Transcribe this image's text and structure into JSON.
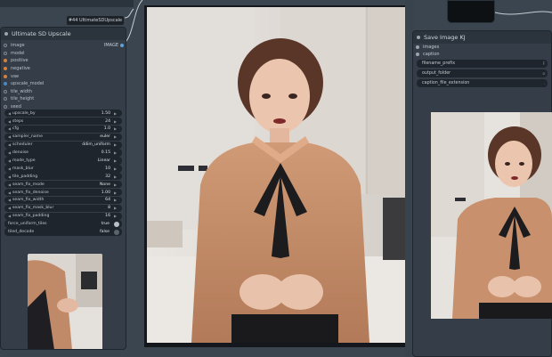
{
  "colors": {
    "canvas": "#3a4550",
    "node_bg": "#353e48",
    "widget_bg": "#1e252c",
    "socket_orange": "#d4823a",
    "socket_blue": "#4f87c9"
  },
  "mini_node": {
    "label": "#44 UltimateSDUpscale"
  },
  "upscale_node": {
    "title": "Ultimate SD Upscale",
    "inputs": [
      {
        "label": "image",
        "socket": "hollow"
      },
      {
        "label": "model",
        "socket": "hollow"
      },
      {
        "label": "positive",
        "socket": "orange"
      },
      {
        "label": "negative",
        "socket": "orange"
      },
      {
        "label": "vae",
        "socket": "orange"
      },
      {
        "label": "upscale_model",
        "socket": "blue"
      },
      {
        "label": "tile_width",
        "socket": "hollow"
      },
      {
        "label": "tile_height",
        "socket": "hollow"
      },
      {
        "label": "seed",
        "socket": "hollow"
      }
    ],
    "output_label": "IMAGE",
    "widgets": [
      {
        "label": "upscale_by",
        "value": "1.50"
      },
      {
        "label": "steps",
        "value": "24"
      },
      {
        "label": "cfg",
        "value": "1.0"
      },
      {
        "label": "sampler_name",
        "value": "euler"
      },
      {
        "label": "scheduler",
        "value": "ddim_uniform"
      },
      {
        "label": "denoise",
        "value": "0.15"
      },
      {
        "label": "mode_type",
        "value": "Linear"
      },
      {
        "label": "mask_blur",
        "value": "10"
      },
      {
        "label": "tile_padding",
        "value": "32"
      },
      {
        "label": "seam_fix_mode",
        "value": "None"
      },
      {
        "label": "seam_fix_denoise",
        "value": "1.00"
      },
      {
        "label": "seam_fix_width",
        "value": "64"
      },
      {
        "label": "seam_fix_mask_blur",
        "value": "8"
      },
      {
        "label": "seam_fix_padding",
        "value": "16"
      }
    ],
    "bool_widgets": [
      {
        "label": "force_uniform_tiles",
        "value": "true"
      },
      {
        "label": "tiled_decode",
        "value": "false"
      }
    ]
  },
  "save_node": {
    "title": "Save Image KJ",
    "inputs": [
      {
        "label": "images"
      },
      {
        "label": "caption"
      }
    ],
    "widgets": [
      {
        "label": "filename_prefix"
      },
      {
        "label": "output_folder"
      },
      {
        "label": "caption_file_extension"
      }
    ]
  }
}
